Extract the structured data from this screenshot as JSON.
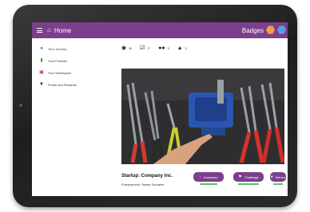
{
  "header": {
    "title": "Home",
    "badges_label": "Badges"
  },
  "sidebar": {
    "items": [
      {
        "label": "Your Journey",
        "icon": "compass-icon",
        "color": "#2f6bd8"
      },
      {
        "label": "Your Portfolio",
        "icon": "document-icon",
        "color": "#3aa845"
      },
      {
        "label": "Your Workspace",
        "icon": "workspace-icon",
        "color": "#d9322e"
      },
      {
        "label": "Points and Rewards",
        "icon": "trophy-icon",
        "color": "#222222"
      }
    ]
  },
  "stats": [
    {
      "icon": "eye-icon",
      "value": "36"
    },
    {
      "icon": "checkbox-icon",
      "value": "17"
    },
    {
      "icon": "people-icon",
      "value": "5"
    },
    {
      "icon": "flame-icon",
      "value": "0"
    }
  ],
  "venture": {
    "company": "Startup: Company Inc.",
    "entrepreneur": "Entrepreneur: Name Surname"
  },
  "actions": [
    {
      "label": "Download"
    },
    {
      "label": "Challenge"
    },
    {
      "label": "Mentor"
    }
  ],
  "colors": {
    "accent": "#7b3f8c",
    "progress": "#5cc06a",
    "badge_orange": "#f0a53a",
    "badge_blue": "#5aa0e0"
  }
}
